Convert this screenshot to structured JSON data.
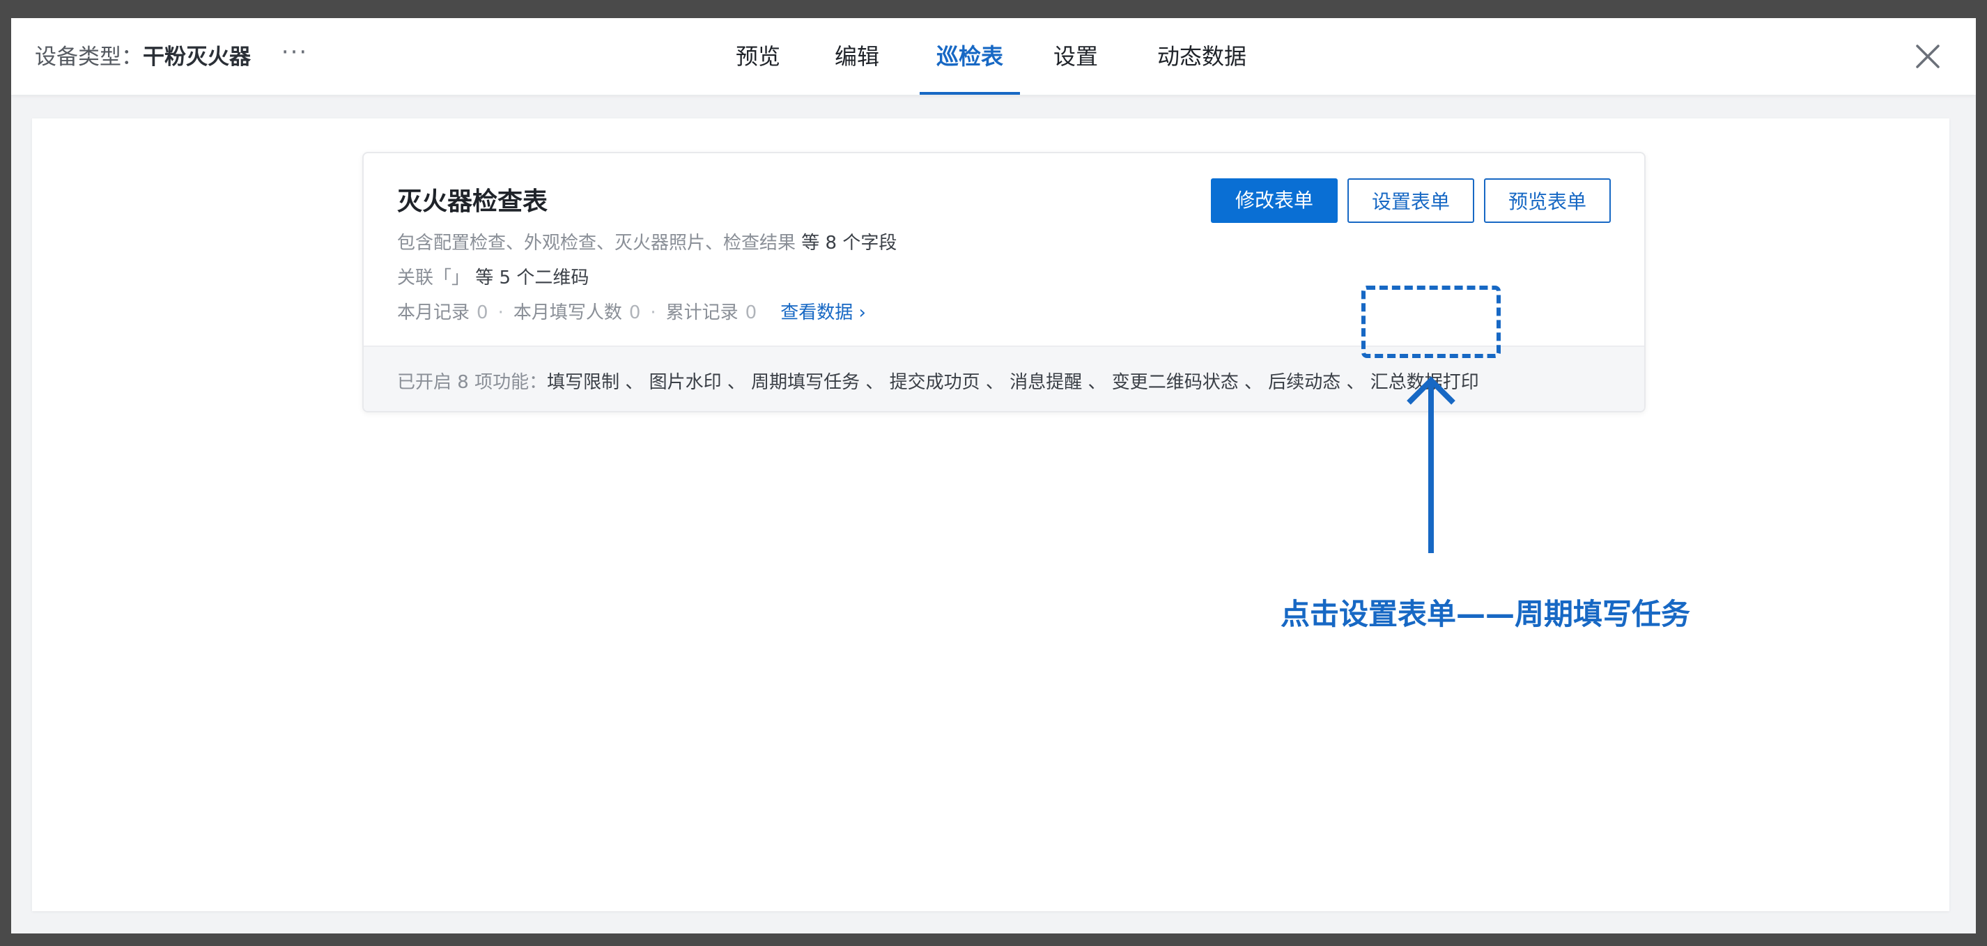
{
  "header": {
    "device_label": "设备类型：",
    "device_name": "干粉灭火器",
    "more": "···",
    "tabs": [
      {
        "label": "预览",
        "active": false
      },
      {
        "label": "编辑",
        "active": false
      },
      {
        "label": "巡检表",
        "active": true
      },
      {
        "label": "设置",
        "active": false
      },
      {
        "label": "动态数据",
        "active": false
      }
    ],
    "close_icon": "close-icon"
  },
  "card": {
    "title": "灭火器检查表",
    "fields_desc": "包含配置检查、外观检查、灭火器照片、检查结果",
    "fields_count": "等 8 个字段",
    "qr_prefix": "关联「」",
    "qr_count": "等 5 个二维码",
    "stats": [
      {
        "label": "本月记录",
        "value": "0"
      },
      {
        "label": "本月填写人数",
        "value": "0"
      },
      {
        "label": "累计记录",
        "value": "0"
      }
    ],
    "view_link": "查看数据 ›",
    "buttons": {
      "edit": "修改表单",
      "settings": "设置表单",
      "preview": "预览表单"
    },
    "features_prefix": "已开启 8 项功能：",
    "features": "填写限制 、 图片水印 、 周期填写任务 、 提交成功页 、 消息提醒 、 变更二维码状态 、 后续动态 、 汇总数据打印"
  },
  "annotation": {
    "text": "点击设置表单——周期填写任务",
    "color": "#1768c4"
  },
  "colors": {
    "accent": "#1768c4",
    "primary_button": "#0a6fd4",
    "backdrop": "#4a4a4a"
  }
}
